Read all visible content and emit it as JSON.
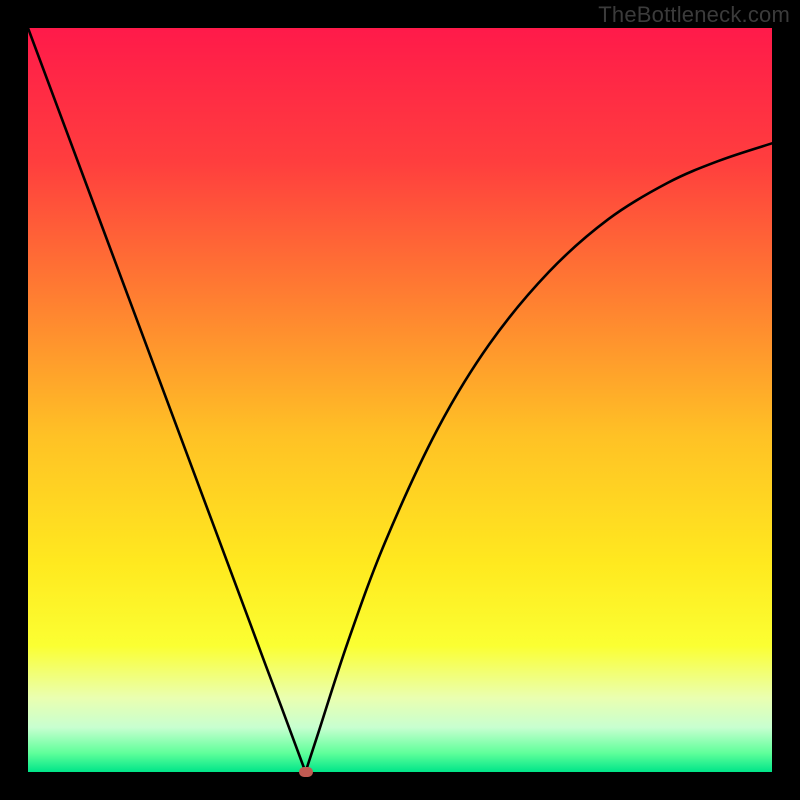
{
  "watermark": "TheBottleneck.com",
  "chart_data": {
    "type": "line",
    "title": "",
    "xlabel": "",
    "ylabel": "",
    "x": [
      0.0,
      0.05,
      0.1,
      0.15,
      0.2,
      0.25,
      0.3,
      0.32,
      0.34,
      0.36,
      0.373,
      0.39,
      0.43,
      0.48,
      0.55,
      0.62,
      0.7,
      0.78,
      0.86,
      0.93,
      1.0
    ],
    "values": [
      1.0,
      0.866,
      0.732,
      0.598,
      0.464,
      0.33,
      0.196,
      0.142,
      0.089,
      0.035,
      0.0,
      0.052,
      0.175,
      0.309,
      0.46,
      0.575,
      0.672,
      0.743,
      0.792,
      0.822,
      0.845
    ],
    "xlim": [
      0,
      1
    ],
    "ylim": [
      0,
      1
    ],
    "min_point": {
      "x": 0.373,
      "y": 0.0,
      "color": "#c15a52"
    },
    "gradient_stops": [
      {
        "pos": 0.0,
        "color": "#ff1a4a"
      },
      {
        "pos": 0.18,
        "color": "#ff3e3e"
      },
      {
        "pos": 0.35,
        "color": "#ff7a32"
      },
      {
        "pos": 0.55,
        "color": "#ffc225"
      },
      {
        "pos": 0.72,
        "color": "#ffe91f"
      },
      {
        "pos": 0.83,
        "color": "#fbff32"
      },
      {
        "pos": 0.9,
        "color": "#eaffb0"
      },
      {
        "pos": 0.94,
        "color": "#c8ffd0"
      },
      {
        "pos": 0.975,
        "color": "#5eff9a"
      },
      {
        "pos": 1.0,
        "color": "#00e589"
      }
    ],
    "curve_color": "#000000",
    "curve_width": 2.6
  }
}
